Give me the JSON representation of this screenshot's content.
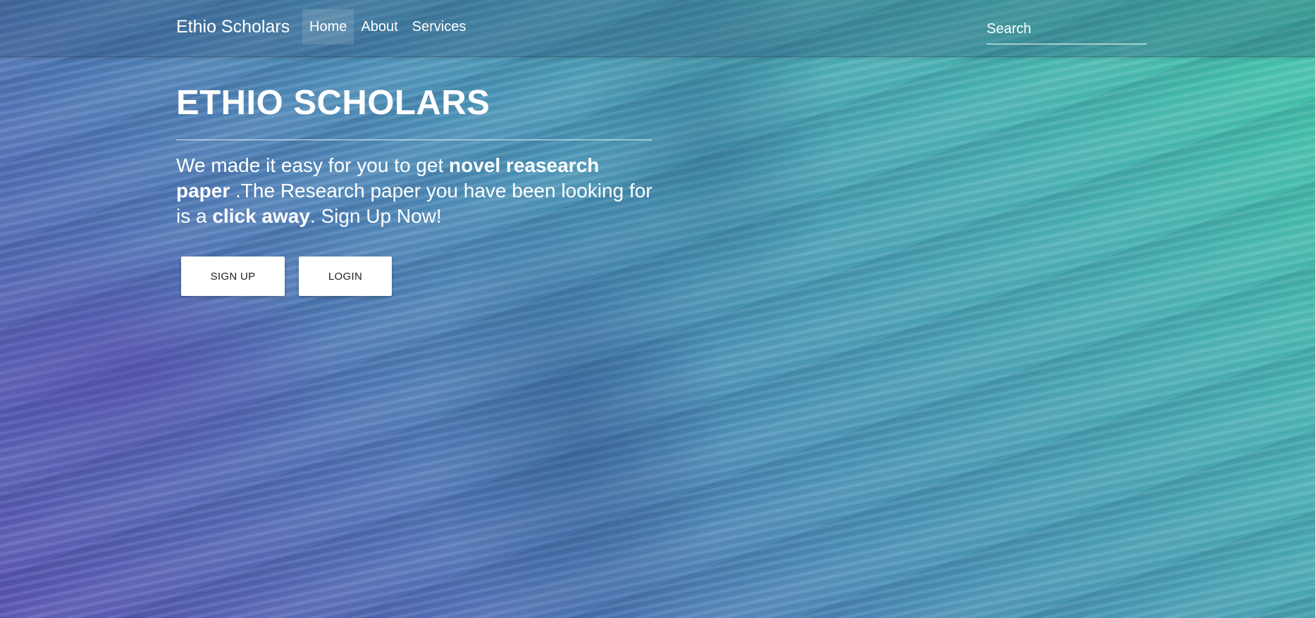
{
  "navbar": {
    "brand": "Ethio Scholars",
    "links": [
      {
        "label": "Home",
        "active": true
      },
      {
        "label": "About",
        "active": false
      },
      {
        "label": "Services",
        "active": false
      }
    ],
    "search": {
      "placeholder": "Search",
      "value": ""
    }
  },
  "hero": {
    "title": "ETHIO SCHOLARS",
    "text_parts": [
      {
        "text": "We made it easy for you to get ",
        "bold": false
      },
      {
        "text": "novel reasearch paper",
        "bold": true
      },
      {
        "text": " .The Research paper you have been looking for is a ",
        "bold": false
      },
      {
        "text": "click away",
        "bold": true
      },
      {
        "text": ". Sign Up Now!",
        "bold": false
      }
    ],
    "buttons": {
      "signup": "SIGN UP",
      "login": "LOGIN"
    }
  },
  "colors": {
    "gradient_start": "#5c55b4",
    "gradient_end": "#44c7a9",
    "button_bg": "#ffffff",
    "button_text": "#1e1e1e"
  }
}
